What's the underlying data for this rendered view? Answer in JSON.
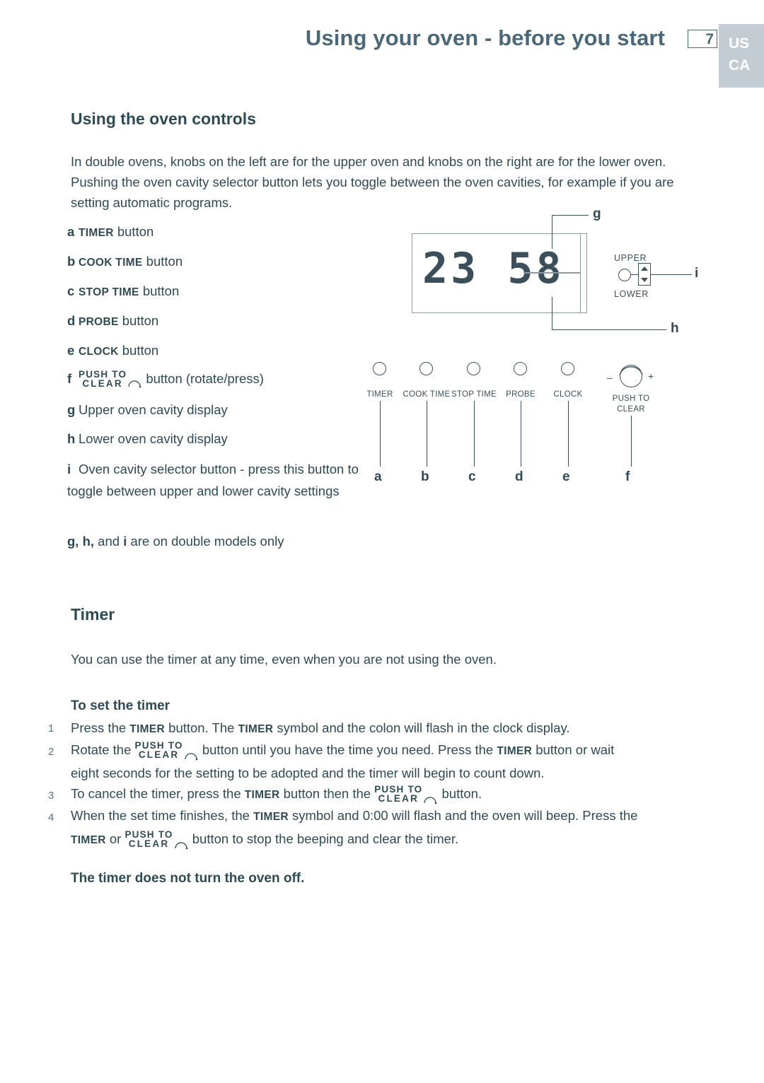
{
  "header": {
    "title": "Using your oven - before you start",
    "page_number": "7",
    "region_lines": [
      "US",
      "CA"
    ]
  },
  "sections": {
    "controls": {
      "heading": "Using the oven controls",
      "intro": "In double ovens, knobs on the left are for the upper oven and knobs on the right are for the lower oven. Pushing the oven cavity selector button lets you toggle between the oven cavities, for example if you are setting automatic programs.",
      "legend": [
        {
          "key": "a",
          "bold": "TIMER",
          "rest": "button"
        },
        {
          "key": "b",
          "bold": "COOK TIME",
          "rest": "button"
        },
        {
          "key": "c",
          "bold": "STOP TIME",
          "rest": "button"
        },
        {
          "key": "d",
          "bold": "PROBE",
          "rest": "button"
        },
        {
          "key": "e",
          "bold": "CLOCK",
          "rest": "button"
        },
        {
          "key": "f",
          "bold": "PUSH TO CLEAR",
          "rest": "button (rotate/press)"
        },
        {
          "key": "g",
          "bold": "",
          "rest": "Upper oven cavity display"
        },
        {
          "key": "h",
          "bold": "",
          "rest": "Lower oven cavity display"
        },
        {
          "key": "i",
          "bold": "",
          "rest": "Oven cavity selector button - press this button to toggle between upper and lower cavity settings"
        }
      ],
      "footnote_keys": "g, h,",
      "footnote_mid": "and",
      "footnote_key_i": "i",
      "footnote_rest": "are on double models only"
    },
    "timer": {
      "heading": "Timer",
      "intro": "You can use the timer at any time, even when you are not using the oven.",
      "subheading": "To set the timer",
      "steps": [
        {
          "num": "1",
          "parts": [
            {
              "t": "Press the ",
              "b": false
            },
            {
              "t": "TIMER",
              "b": true
            },
            {
              "t": " button.  The ",
              "b": false
            },
            {
              "t": "TIMER",
              "b": true
            },
            {
              "t": " symbol and the colon will flash in the clock display.",
              "b": false
            }
          ]
        },
        {
          "num": "2",
          "parts": [
            {
              "t": "Rotate the ",
              "b": false
            },
            {
              "t": "PUSH TO CLEAR",
              "b": "glyph"
            },
            {
              "t": " button until you have the time you need.  Press the ",
              "b": false
            },
            {
              "t": "TIMER",
              "b": true
            },
            {
              "t": " button or wait eight seconds for the setting to be adopted and the timer will begin to count down.",
              "b": false
            }
          ]
        },
        {
          "num": "3",
          "parts": [
            {
              "t": "To cancel the timer, press the ",
              "b": false
            },
            {
              "t": "TIMER",
              "b": true
            },
            {
              "t": " button then the ",
              "b": false
            },
            {
              "t": "PUSH TO CLEAR",
              "b": "glyph"
            },
            {
              "t": " button.",
              "b": false
            }
          ]
        },
        {
          "num": "4",
          "parts": [
            {
              "t": "When the set time finishes, the ",
              "b": false
            },
            {
              "t": "TIMER",
              "b": true
            },
            {
              "t": " symbol and 0:00 will flash and the oven will beep. Press the ",
              "b": false
            },
            {
              "t": "TIMER",
              "b": true
            },
            {
              "t": " or ",
              "b": false
            },
            {
              "t": "PUSH TO CLEAR",
              "b": "glyph"
            },
            {
              "t": " button to stop the beeping and clear the timer.",
              "b": false
            }
          ]
        }
      ],
      "closing": "The timer does not turn the oven off."
    }
  },
  "diagram": {
    "display_value": "23 58",
    "label_upper": "UPPER",
    "label_lower": "LOWER",
    "callouts": {
      "g": "g",
      "h": "h",
      "i": "i"
    },
    "buttons": [
      {
        "label": "TIMER",
        "callout": "a"
      },
      {
        "label": "COOK TIME",
        "callout": "b"
      },
      {
        "label": "STOP TIME",
        "callout": "c"
      },
      {
        "label": "PROBE",
        "callout": "d"
      },
      {
        "label": "CLOCK",
        "callout": "e"
      }
    ],
    "knob": {
      "label_line1": "PUSH TO",
      "label_line2": "CLEAR",
      "callout": "f",
      "minus": "–",
      "plus": "+"
    }
  },
  "step_text": {
    "s1_a": "Press the ",
    "s1_b1": "TIMER",
    "s1_c": " button.  The ",
    "s1_b2": "TIMER",
    "s1_d": " symbol and the colon will flash in the clock display.",
    "s2_a": "Rotate the ",
    "s2_c": " button until you have the time you need.  Press the ",
    "s2_b": "TIMER",
    "s2_d": " button or wait",
    "s2_line2": "eight seconds for the setting to be adopted and the timer will begin to count down.",
    "s3_a": "To cancel the timer, press the ",
    "s3_b": "TIMER",
    "s3_c": " button then the ",
    "s3_d": " button.",
    "s4_a": "When the set time finishes, the ",
    "s4_b": "TIMER",
    "s4_c": " symbol and 0:00 will flash and the oven will beep. Press the",
    "s4_b2": "TIMER",
    "s4_or": " or ",
    "s4_d": " button to stop the beeping and clear the timer."
  }
}
